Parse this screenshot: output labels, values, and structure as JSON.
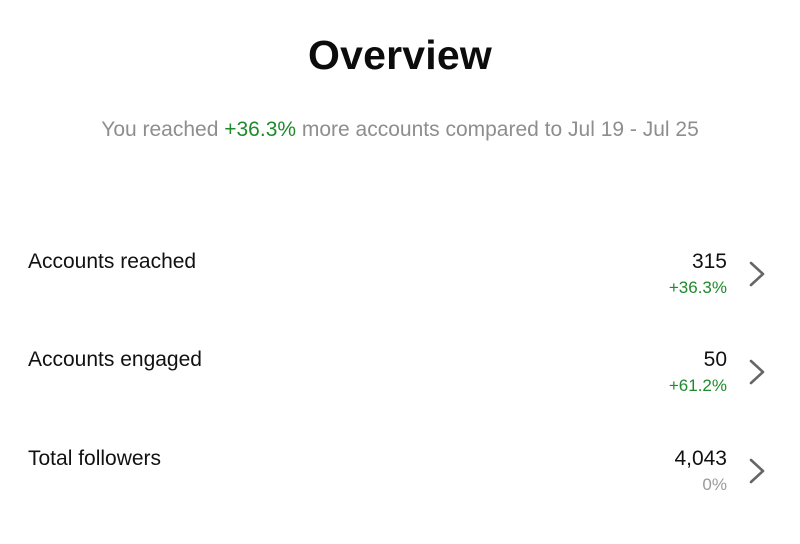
{
  "header": {
    "title": "Overview"
  },
  "summary": {
    "prefix": "You reached ",
    "highlight": "+36.3%",
    "suffix": " more accounts compared to Jul 19 - Jul 25"
  },
  "metrics": [
    {
      "label": "Accounts reached",
      "value": "315",
      "change": "+36.3%",
      "change_color": "#1f8a2c"
    },
    {
      "label": "Accounts engaged",
      "value": "50",
      "change": "+61.2%",
      "change_color": "#1f8a2c"
    },
    {
      "label": "Total followers",
      "value": "4,043",
      "change": "0%",
      "change_color": "#9a9a9a"
    }
  ],
  "icons": {
    "row_chevron": "chevron-right-icon"
  }
}
